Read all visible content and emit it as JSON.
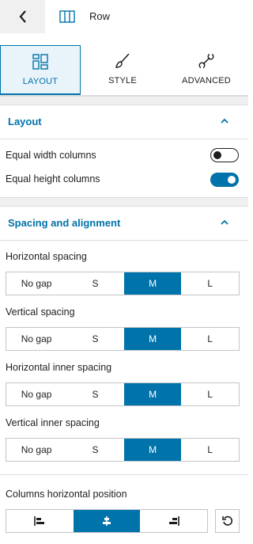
{
  "header": {
    "block_name": "Row"
  },
  "tabs": [
    {
      "label": "LAYOUT",
      "icon": "layout-icon",
      "active": true
    },
    {
      "label": "STYLE",
      "icon": "brush-icon",
      "active": false
    },
    {
      "label": "ADVANCED",
      "icon": "wrench-icon",
      "active": false
    }
  ],
  "layout_section": {
    "title": "Layout",
    "equal_width": {
      "label": "Equal width columns",
      "enabled": false
    },
    "equal_height": {
      "label": "Equal height columns",
      "enabled": true
    }
  },
  "spacing_section": {
    "title": "Spacing and alignment",
    "controls": [
      {
        "label": "Horizontal spacing",
        "options": [
          "No gap",
          "S",
          "M",
          "L"
        ],
        "selected": "M"
      },
      {
        "label": "Vertical spacing",
        "options": [
          "No gap",
          "S",
          "M",
          "L"
        ],
        "selected": "M"
      },
      {
        "label": "Horizontal inner spacing",
        "options": [
          "No gap",
          "S",
          "M",
          "L"
        ],
        "selected": "M"
      },
      {
        "label": "Vertical inner spacing",
        "options": [
          "No gap",
          "S",
          "M",
          "L"
        ],
        "selected": "M"
      }
    ],
    "columns_position": {
      "label": "Columns horizontal position",
      "options": [
        "align-left-icon",
        "align-center-icon",
        "align-right-icon"
      ],
      "selected": "align-center-icon"
    }
  },
  "colors": {
    "accent": "#0073aa",
    "accent_bg": "#e8f3fa",
    "border": "#dcdcde"
  }
}
